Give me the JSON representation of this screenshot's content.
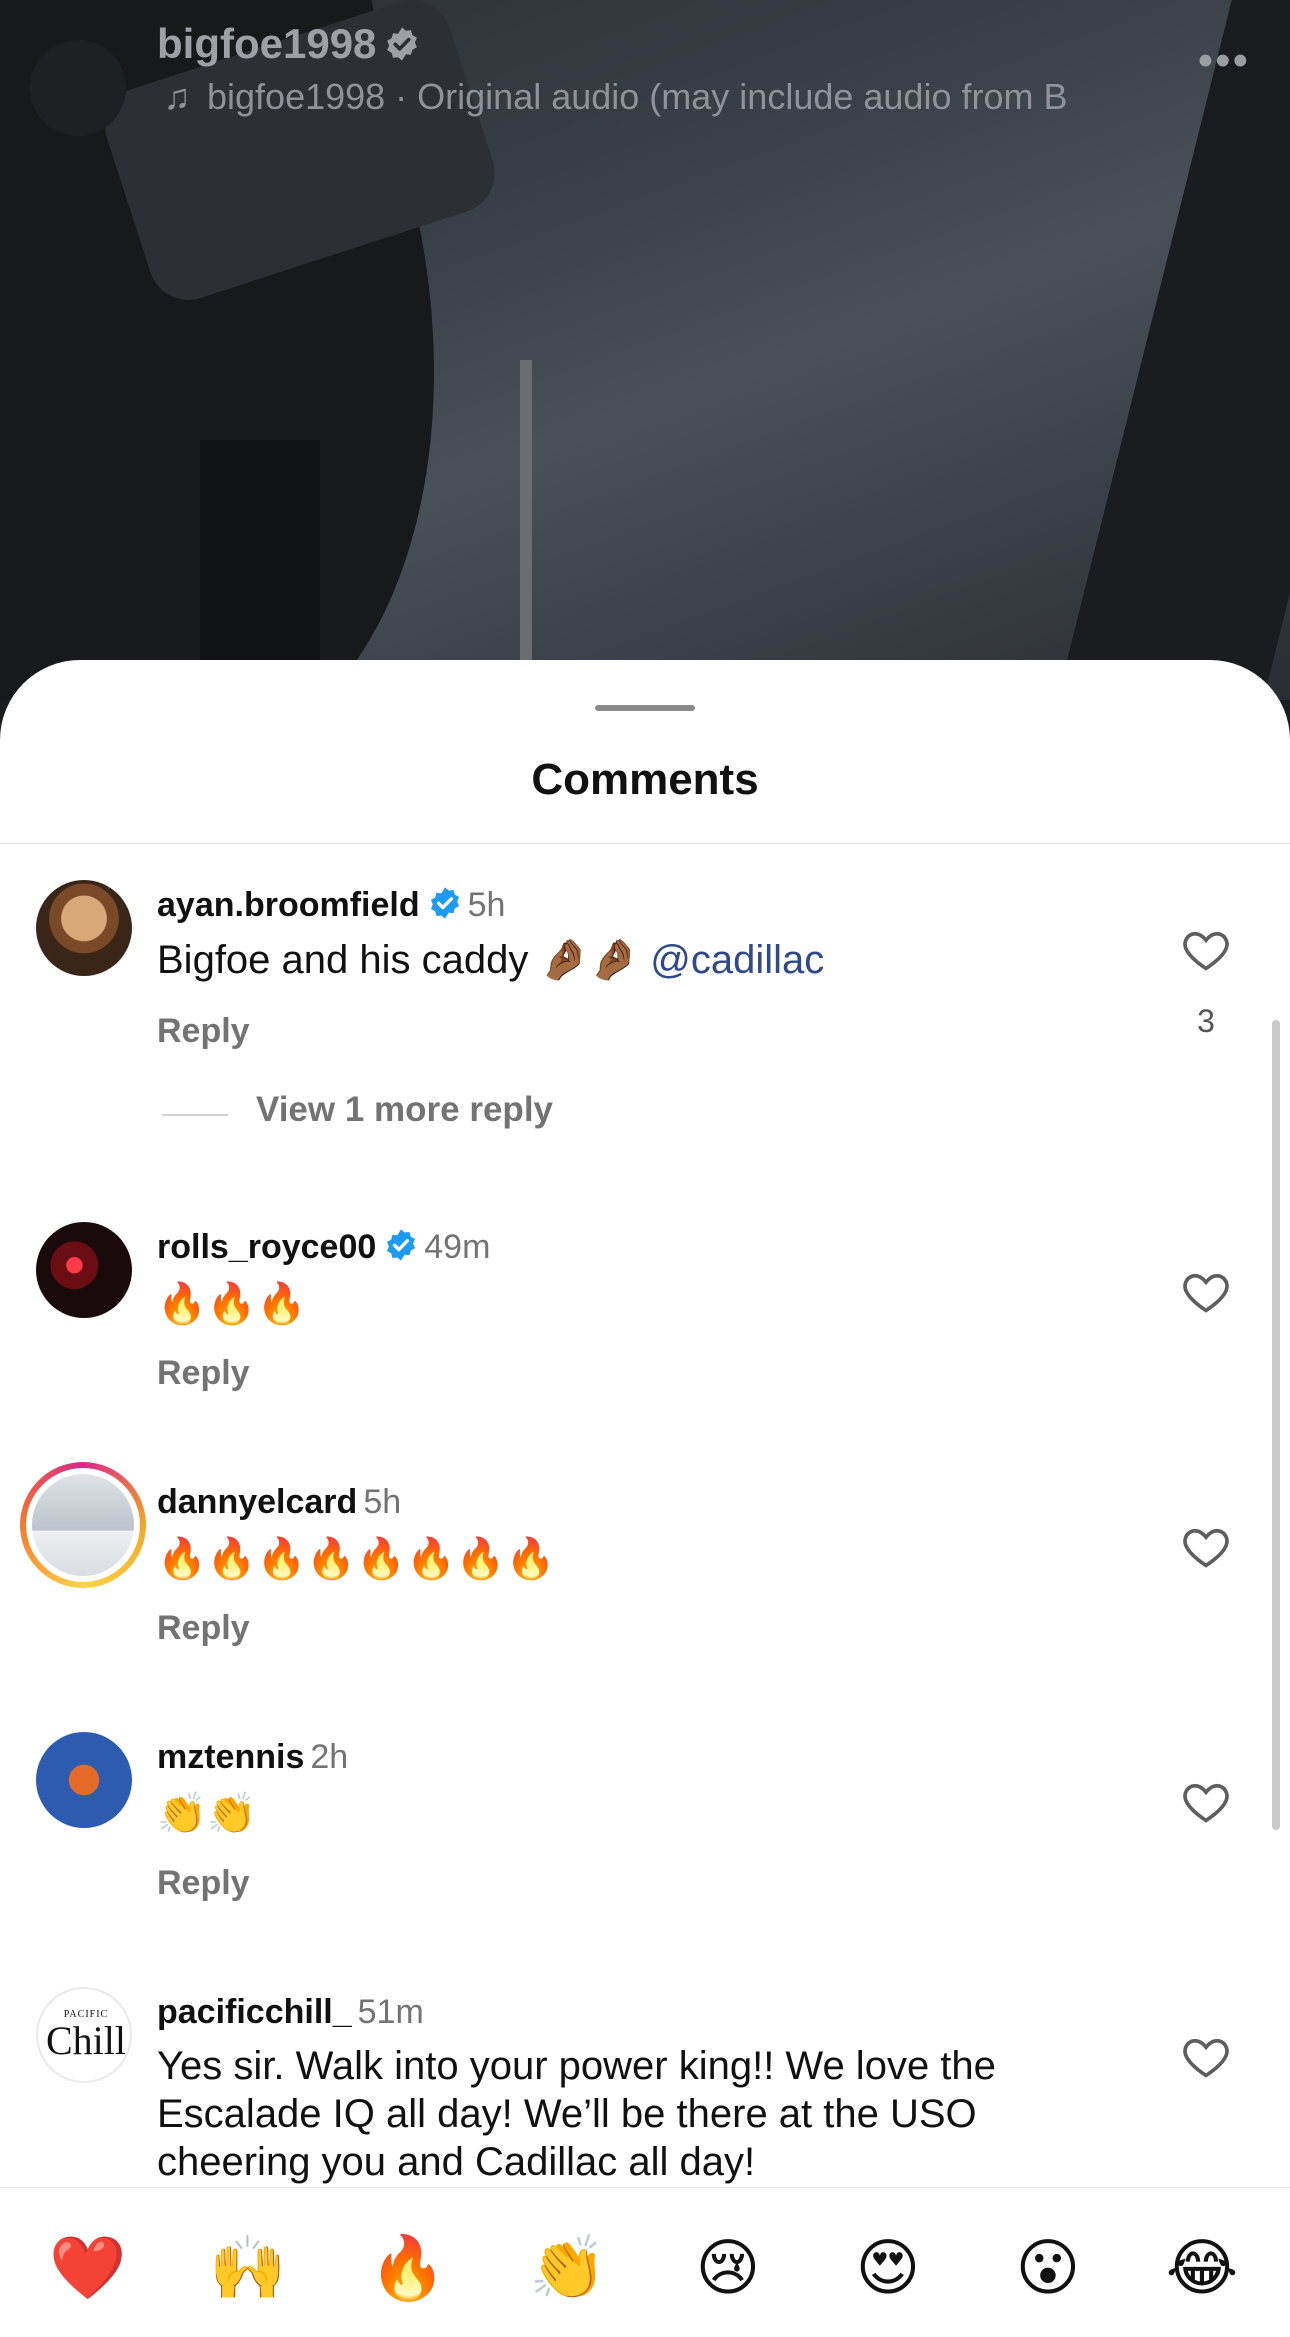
{
  "post": {
    "username": "bigfoe1998",
    "audio_text": "bigfoe1998 · Original audio  (may include audio from B",
    "more_icon": "more-horizontal-icon"
  },
  "sheet": {
    "title": "Comments"
  },
  "comments": [
    {
      "username": "ayan.broomfield",
      "verified": true,
      "time": "5h",
      "text_main": "Bigfoe and his caddy 🤌🏾🤌🏾",
      "mention": "@cadillac",
      "reply_label": "Reply",
      "likes": "3",
      "view_more": "View 1 more reply"
    },
    {
      "username": "rolls_royce00",
      "verified": true,
      "time": "49m",
      "text_main": "🔥🔥🔥",
      "reply_label": "Reply"
    },
    {
      "username": "dannyelcard",
      "verified": false,
      "time": "5h",
      "text_main": "🔥🔥🔥🔥🔥🔥🔥🔥",
      "reply_label": "Reply"
    },
    {
      "username": "mztennis",
      "verified": false,
      "time": "2h",
      "text_main": "👏👏",
      "reply_label": "Reply"
    },
    {
      "username": "pacificchill_",
      "verified": false,
      "time": "51m",
      "text_main": "Yes sir. Walk into your power king!! We love the Escalade IQ all day! We’ll be there at the USO cheering you and Cadillac all day!",
      "avatar_small_text": "PACIFIC",
      "avatar_big_text": "Chill"
    }
  ],
  "reactions": [
    "❤️",
    "🙌",
    "🔥",
    "👏",
    "😢",
    "😍",
    "😮",
    "😂"
  ],
  "colors": {
    "verified_blue": "#1d9bf0",
    "mention_blue": "#2f4a8a",
    "muted_text": "#737373"
  }
}
